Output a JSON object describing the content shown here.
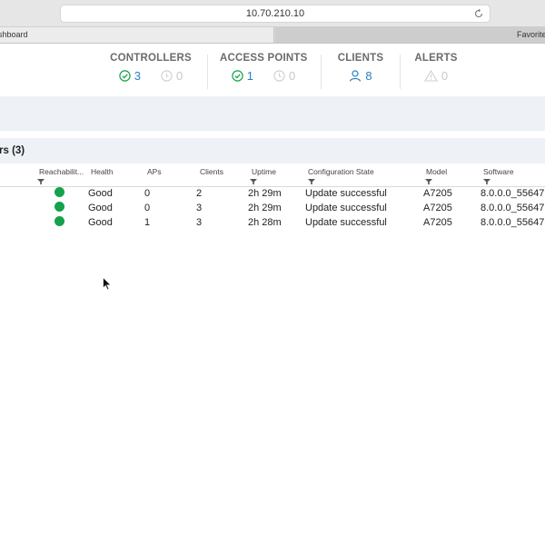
{
  "browser": {
    "url": "10.70.210.10",
    "tabs": [
      {
        "label": "shboard"
      },
      {
        "label": "Favorites"
      }
    ]
  },
  "summary": [
    {
      "title": "CONTROLLERS",
      "primary_icon": "check-circle-icon",
      "primary": "3",
      "secondary_icon": "clock-circle-icon",
      "secondary": "0"
    },
    {
      "title": "ACCESS POINTS",
      "primary_icon": "check-circle-icon",
      "primary": "1",
      "secondary_icon": "clock-circle-icon",
      "secondary": "0"
    },
    {
      "title": "CLIENTS",
      "primary_icon": "user-icon",
      "primary": "8"
    },
    {
      "title": "ALERTS",
      "primary_icon": "warning-triangle-icon",
      "primary": "0"
    }
  ],
  "section": {
    "title": "rs (3)"
  },
  "table": {
    "headers": [
      "Reachabilit...",
      "Health",
      "APs",
      "Clients",
      "Uptime",
      "Configuration State",
      "Model",
      "Software"
    ],
    "rows": [
      {
        "reachability": "reachable",
        "health": "Good",
        "aps": "0",
        "clients": "2",
        "uptime": "2h 29m",
        "config_state": "Update successful",
        "model": "A7205",
        "software": "8.0.0.0_55647"
      },
      {
        "reachability": "reachable",
        "health": "Good",
        "aps": "0",
        "clients": "3",
        "uptime": "2h 29m",
        "config_state": "Update successful",
        "model": "A7205",
        "software": "8.0.0.0_55647"
      },
      {
        "reachability": "reachable",
        "health": "Good",
        "aps": "1",
        "clients": "3",
        "uptime": "2h 28m",
        "config_state": "Update successful",
        "model": "A7205",
        "software": "8.0.0.0_55647"
      }
    ]
  },
  "colors": {
    "ok_green": "#14a24a",
    "link_blue": "#2b7fbf",
    "muted_gray": "#c8c8c8",
    "band": "#eef1f5"
  }
}
